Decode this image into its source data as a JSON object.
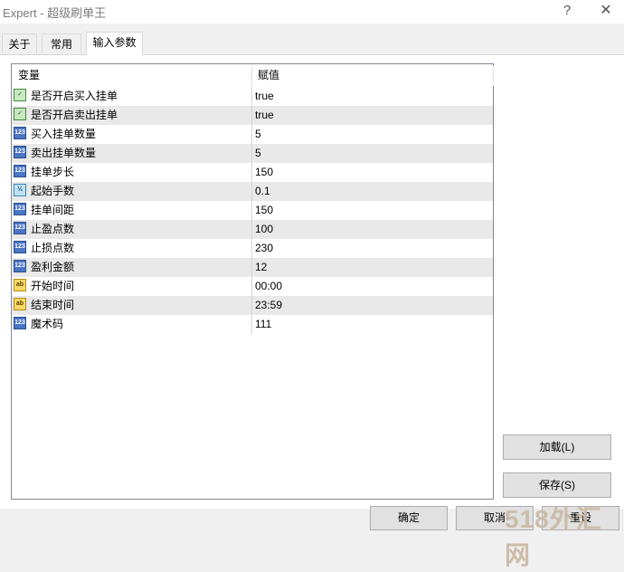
{
  "window": {
    "title": "Expert - 超级刷单王",
    "help_label": "?",
    "close_label": "✕"
  },
  "tabs": [
    {
      "label": "关于",
      "active": false
    },
    {
      "label": "常用",
      "active": false
    },
    {
      "label": "输入参数",
      "active": true
    }
  ],
  "grid": {
    "columns": [
      "变量",
      "赋值"
    ],
    "rows": [
      {
        "name": "是否开启买入挂单",
        "value": "true",
        "type": "bool",
        "icon": "bool-icon"
      },
      {
        "name": "是否开启卖出挂单",
        "value": "true",
        "type": "bool",
        "icon": "bool-icon"
      },
      {
        "name": "买入挂单数量",
        "value": "5",
        "type": "int",
        "icon": "integer-icon"
      },
      {
        "name": "卖出挂单数量",
        "value": "5",
        "type": "int",
        "icon": "integer-icon"
      },
      {
        "name": "挂单步长",
        "value": "150",
        "type": "int",
        "icon": "integer-icon"
      },
      {
        "name": "起始手数",
        "value": "0.1",
        "type": "double",
        "icon": "double-icon"
      },
      {
        "name": "挂单间距",
        "value": "150",
        "type": "int",
        "icon": "integer-icon"
      },
      {
        "name": "止盈点数",
        "value": "100",
        "type": "int",
        "icon": "integer-icon"
      },
      {
        "name": "止损点数",
        "value": "230",
        "type": "int",
        "icon": "integer-icon"
      },
      {
        "name": "盈利金额",
        "value": "12",
        "type": "int",
        "icon": "integer-icon"
      },
      {
        "name": "开始时间",
        "value": "00:00",
        "type": "string",
        "icon": "string-icon"
      },
      {
        "name": "结束时间",
        "value": "23:59",
        "type": "string",
        "icon": "string-icon"
      },
      {
        "name": "魔术码",
        "value": "111",
        "type": "int",
        "icon": "integer-icon"
      }
    ],
    "icon_glyphs": {
      "bool": "✓",
      "int": "123",
      "double": "½",
      "string": "ab"
    }
  },
  "buttons": {
    "load": "加载(L)",
    "save": "保存(S)",
    "ok": "确定",
    "cancel": "取消",
    "reset": "重设"
  },
  "watermark": "518外汇网"
}
